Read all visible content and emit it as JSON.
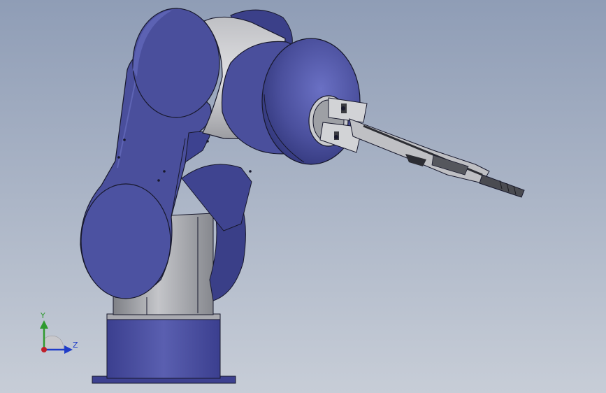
{
  "viewport": {
    "background_top": "#8f9db6",
    "background_bottom": "#c7cdd7"
  },
  "model": {
    "link_color": "#4a4f9c",
    "link_color_dark": "#343a7e",
    "link_highlight": "#5c62b3",
    "base_gray": "#a8a8ad",
    "base_gray_dark": "#7b7d83",
    "outline": "#17182c"
  },
  "triad": {
    "y_label": "Y",
    "z_label": "Z",
    "y_color": "#2f9a2f",
    "z_color": "#1f3cc8",
    "x_dot_color": "#c0202a"
  }
}
